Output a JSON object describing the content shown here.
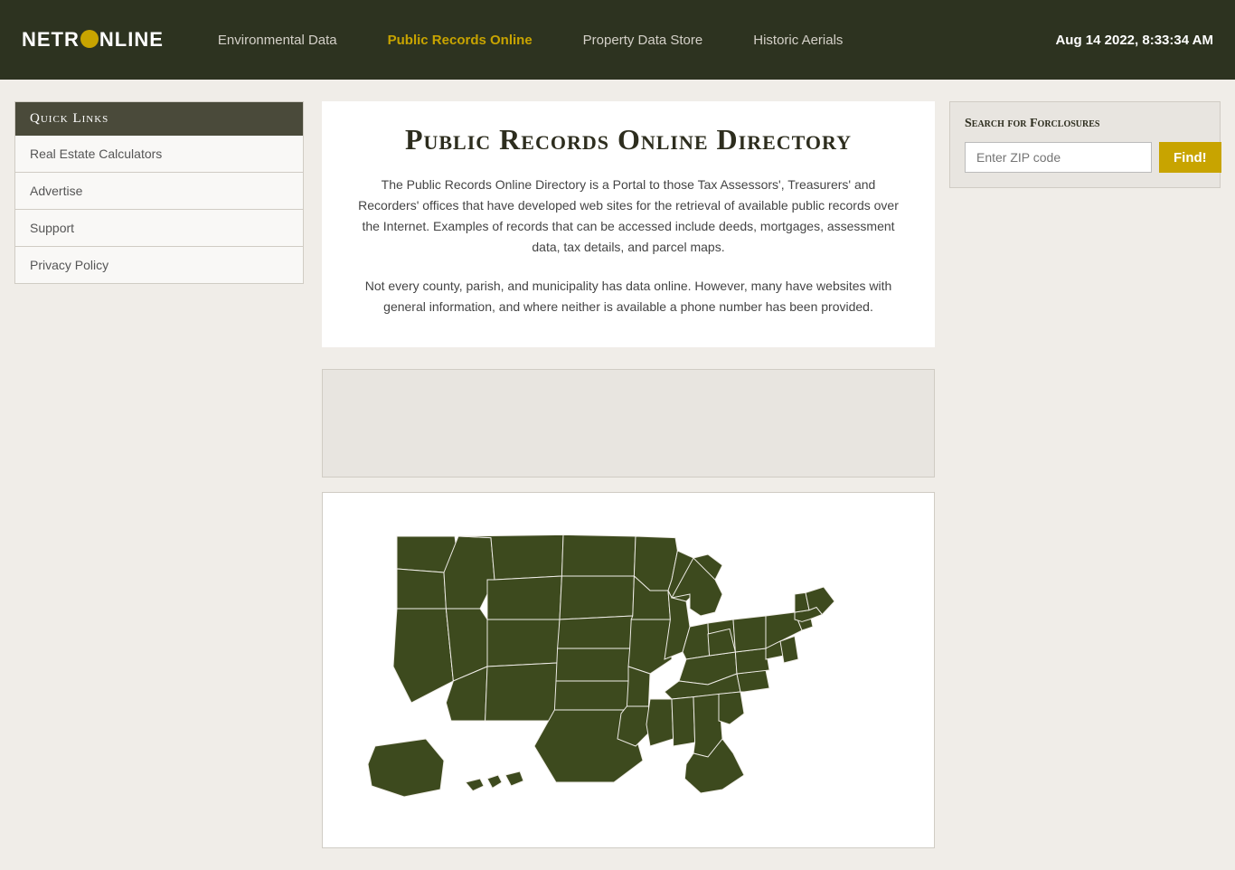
{
  "header": {
    "logo": "NETRⓄNLINE",
    "nav": [
      {
        "id": "environmental-data",
        "label": "Environmental Data",
        "active": false
      },
      {
        "id": "public-records-online",
        "label": "Public Records Online",
        "active": true
      },
      {
        "id": "property-data-store",
        "label": "Property Data Store",
        "active": false
      },
      {
        "id": "historic-aerials",
        "label": "Historic Aerials",
        "active": false
      }
    ],
    "datetime": "Aug 14 2022, 8:33:34 AM"
  },
  "sidebar": {
    "quicklinks_title": "Quick Links",
    "items": [
      {
        "label": "Real Estate Calculators"
      },
      {
        "label": "Advertise"
      },
      {
        "label": "Support"
      },
      {
        "label": "Privacy Policy"
      }
    ]
  },
  "main": {
    "page_title": "Public Records Online Directory",
    "description1": "The Public Records Online Directory is a Portal to those Tax Assessors', Treasurers' and Recorders' offices that have developed web sites for the retrieval of available public records over the Internet. Examples of records that can be accessed include deeds, mortgages, assessment data, tax details, and parcel maps.",
    "description2": "Not every county, parish, and municipality has data online. However, many have websites with general information, and where neither is available a phone number has been provided."
  },
  "right_panel": {
    "foreclosure_title": "Search for Forclosures",
    "zip_placeholder": "Enter ZIP code",
    "find_button_label": "Find!"
  }
}
